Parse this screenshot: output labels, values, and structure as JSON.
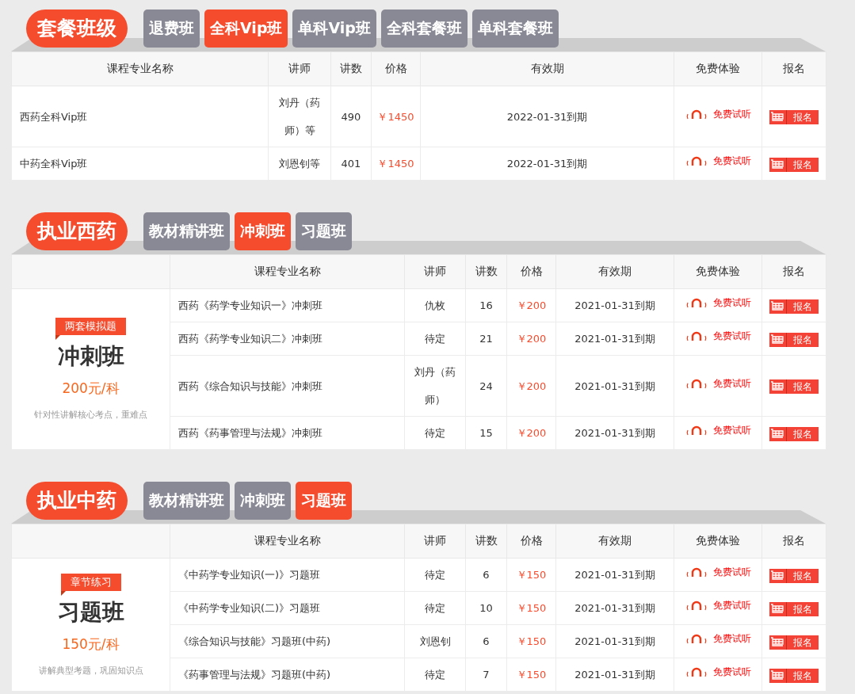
{
  "sections": [
    {
      "title": "套餐班级",
      "tabs": [
        {
          "label": "退费班",
          "selected": false
        },
        {
          "label": "全科Vip班",
          "selected": true
        },
        {
          "label": "单科Vip班",
          "selected": false
        },
        {
          "label": "全科套餐班",
          "selected": false
        },
        {
          "label": "单科套餐班",
          "selected": false
        }
      ],
      "columns": [
        "课程专业名称",
        "讲师",
        "讲数",
        "价格",
        "有效期",
        "免费体验",
        "报名"
      ],
      "rows": [
        {
          "name": "西药全科Vip班",
          "teacher": "刘丹（药师）等",
          "lessons": "490",
          "price": "￥1450",
          "validity": "2022-01-31到期",
          "trial": "免费试听",
          "signup": "报名"
        },
        {
          "name": "中药全科Vip班",
          "teacher": "刘恩钊等",
          "lessons": "401",
          "price": "￥1450",
          "validity": "2022-01-31到期",
          "trial": "免费试听",
          "signup": "报名"
        }
      ]
    },
    {
      "title": "执业西药",
      "tabs": [
        {
          "label": "教材精讲班",
          "selected": false
        },
        {
          "label": "冲刺班",
          "selected": true
        },
        {
          "label": "习题班",
          "selected": false
        }
      ],
      "side": {
        "tag": "两套模拟题",
        "title": "冲刺班",
        "price": "200元/科",
        "note": "针对性讲解核心考点，重难点"
      },
      "columns": [
        "课程专业名称",
        "讲师",
        "讲数",
        "价格",
        "有效期",
        "免费体验",
        "报名"
      ],
      "rows": [
        {
          "name": "西药《药学专业知识一》冲刺班",
          "teacher": "仇枚",
          "lessons": "16",
          "price": "￥200",
          "validity": "2021-01-31到期",
          "trial": "免费试听",
          "signup": "报名"
        },
        {
          "name": "西药《药学专业知识二》冲刺班",
          "teacher": "待定",
          "lessons": "21",
          "price": "￥200",
          "validity": "2021-01-31到期",
          "trial": "免费试听",
          "signup": "报名"
        },
        {
          "name": "西药《综合知识与技能》冲刺班",
          "teacher": "刘丹（药师）",
          "lessons": "24",
          "price": "￥200",
          "validity": "2021-01-31到期",
          "trial": "免费试听",
          "signup": "报名"
        },
        {
          "name": "西药《药事管理与法规》冲刺班",
          "teacher": "待定",
          "lessons": "15",
          "price": "￥200",
          "validity": "2021-01-31到期",
          "trial": "免费试听",
          "signup": "报名"
        }
      ]
    },
    {
      "title": "执业中药",
      "tabs": [
        {
          "label": "教材精讲班",
          "selected": false
        },
        {
          "label": "冲刺班",
          "selected": false
        },
        {
          "label": "习题班",
          "selected": true
        }
      ],
      "side": {
        "tag": "章节练习",
        "title": "习题班",
        "price": "150元/科",
        "note": "讲解典型考题，巩固知识点"
      },
      "columns": [
        "课程专业名称",
        "讲师",
        "讲数",
        "价格",
        "有效期",
        "免费体验",
        "报名"
      ],
      "rows": [
        {
          "name": "《中药学专业知识(一)》习题班",
          "teacher": "待定",
          "lessons": "6",
          "price": "￥150",
          "validity": "2021-01-31到期",
          "trial": "免费试听",
          "signup": "报名"
        },
        {
          "name": "《中药学专业知识(二)》习题班",
          "teacher": "待定",
          "lessons": "10",
          "price": "￥150",
          "validity": "2021-01-31到期",
          "trial": "免费试听",
          "signup": "报名"
        },
        {
          "name": "《综合知识与技能》习题班(中药)",
          "teacher": "刘恩钊",
          "lessons": "6",
          "price": "￥150",
          "validity": "2021-01-31到期",
          "trial": "免费试听",
          "signup": "报名"
        },
        {
          "name": "《药事管理与法规》习题班(中药)",
          "teacher": "待定",
          "lessons": "7",
          "price": "￥150",
          "validity": "2021-01-31到期",
          "trial": "免费试听",
          "signup": "报名"
        }
      ]
    }
  ]
}
